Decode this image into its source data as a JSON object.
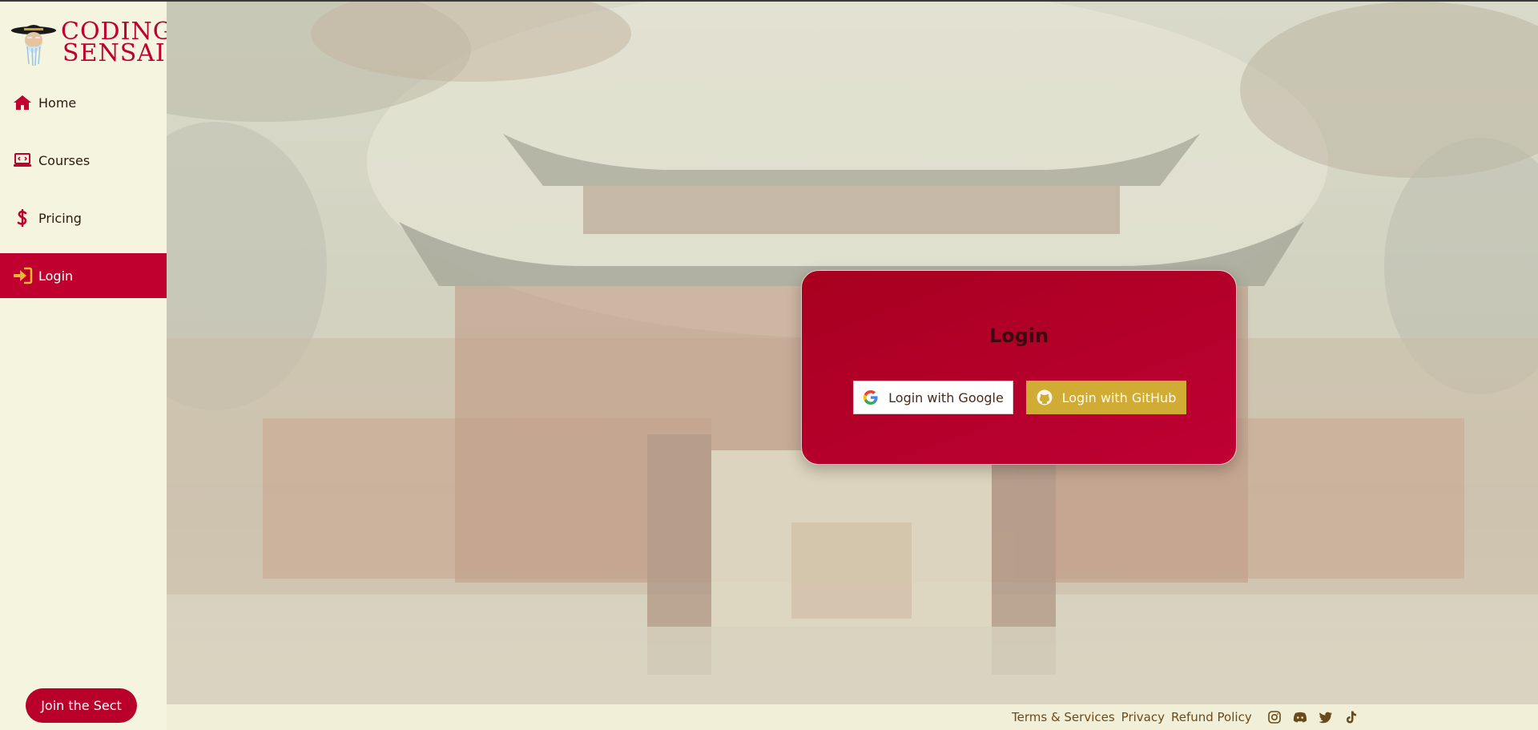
{
  "brand": {
    "line1": "CODING",
    "line2": "SENSAI"
  },
  "nav": {
    "items": [
      {
        "label": "Home",
        "icon": "home-icon"
      },
      {
        "label": "Courses",
        "icon": "laptop-code-icon"
      },
      {
        "label": "Pricing",
        "icon": "dollar-icon"
      },
      {
        "label": "Login",
        "icon": "sign-in-icon",
        "active": true
      }
    ]
  },
  "join_button": "Join the Sect",
  "login_card": {
    "title": "Login",
    "google_button": "Login with Google",
    "github_button": "Login with GitHub"
  },
  "footer": {
    "links": [
      "Terms & Services",
      "Privacy",
      "Refund Policy"
    ],
    "icons": [
      "instagram-icon",
      "discord-icon",
      "twitter-icon",
      "tiktok-icon"
    ]
  },
  "colors": {
    "brand_red": "#c0002e",
    "cream": "#f4f4df",
    "gold": "#d0ac34"
  }
}
